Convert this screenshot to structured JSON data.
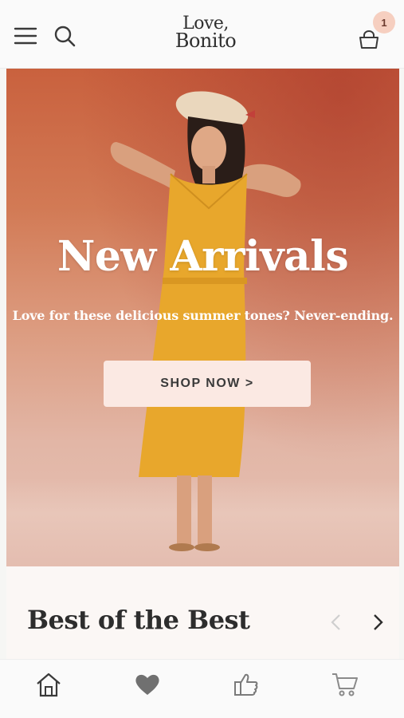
{
  "header": {
    "logo_line1": "Love,",
    "logo_line2": "Bonito",
    "cart_count": "1",
    "icons": [
      "hamburger-menu-icon",
      "search-icon",
      "shopping-bag-icon"
    ]
  },
  "hero": {
    "title": "New Arrivals",
    "subtitle": "Love for these delicious summer tones? Never-ending.",
    "cta_label": "SHOP NOW >"
  },
  "section": {
    "title": "Best of the Best",
    "icons": [
      "chevron-left-icon",
      "chevron-right-icon"
    ]
  },
  "bottom_nav": {
    "icons": [
      "home-icon",
      "heart-icon",
      "thumbs-up-icon",
      "cart-icon"
    ]
  },
  "colors": {
    "accent_badge": "#f6cfc0",
    "cta_background": "#fbe9e3",
    "dress": "#e8a72c"
  }
}
